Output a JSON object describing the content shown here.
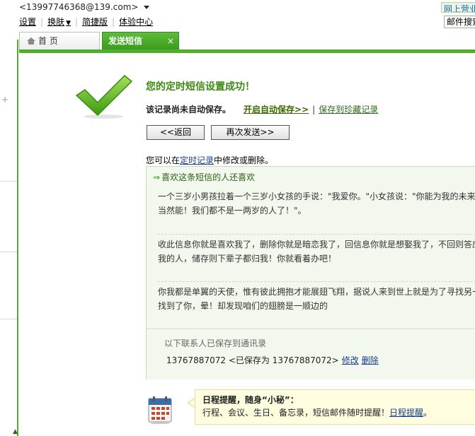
{
  "header": {
    "account": "<13997746368@139.com>",
    "menu": [
      "设置",
      "换肤",
      "简捷版",
      "体验中心"
    ],
    "skin_arrow": "▼",
    "right_link": "网上营业厅",
    "right_input": "邮件搜索"
  },
  "tabs": {
    "home": "首 页",
    "sms": "发送短信",
    "close": "×"
  },
  "result": {
    "title": "您的定时短信设置成功！",
    "note": "该记录尚未自动保存。",
    "auto_save": "开启自动保存>>",
    "pipe": "|",
    "save_favorite": "保存到珍藏记录",
    "back_button": "<<返回",
    "resend_button": "再次发送>>",
    "modify_prefix": "您可以在",
    "modify_link": "定时记录",
    "modify_suffix": "中修改或删除。"
  },
  "suggest": {
    "arrow": "⇒",
    "heading": "喜欢这条短信的人还喜欢",
    "items": [
      {
        "l1": "一个三岁小男孩拉着一个三岁小女孩的手说：\"我爱你。\"小女孩说：\"你能为我的未来负责吗？\"小男孩说：\"当然",
        "l2": "当然能！我们都不是一两岁的人了！\"。"
      },
      {
        "l1": "收此信息你就是喜欢我了，删除你就是暗恋我了，回信息你就是想娶我了，不回则答应做",
        "l2": "我的人，储存则下辈子都归我！你就看着办吧！"
      },
      {
        "l1": "你我都是单翼的天使，惟有彼此拥抱才能展翅飞翔，据说人来到世上就是为了寻找另一只翅膀",
        "l2": "找到了你，晕！却发现咱们的翅膀是一顺边的"
      }
    ]
  },
  "saved": {
    "title": "以下联系人已保存到通讯录",
    "number": "13767887072",
    "detail": "<已保存为 13767887072>",
    "edit": "修改",
    "delete": "删除"
  },
  "tip": {
    "title": "日程提醒，随身“小秘”：",
    "text": "行程、会议、生日、备忘录，短信邮件随时提醒！",
    "link": "日程提醒",
    "end": "。"
  },
  "colors": {
    "brand_green": "#4fae2a",
    "success_text": "#3a8a10",
    "link_blue": "#1a3d8f"
  },
  "icons": [
    "home-icon",
    "close-icon",
    "checkmark-icon",
    "calendar-icon",
    "arrow-right-icon",
    "caret-down-icon"
  ]
}
